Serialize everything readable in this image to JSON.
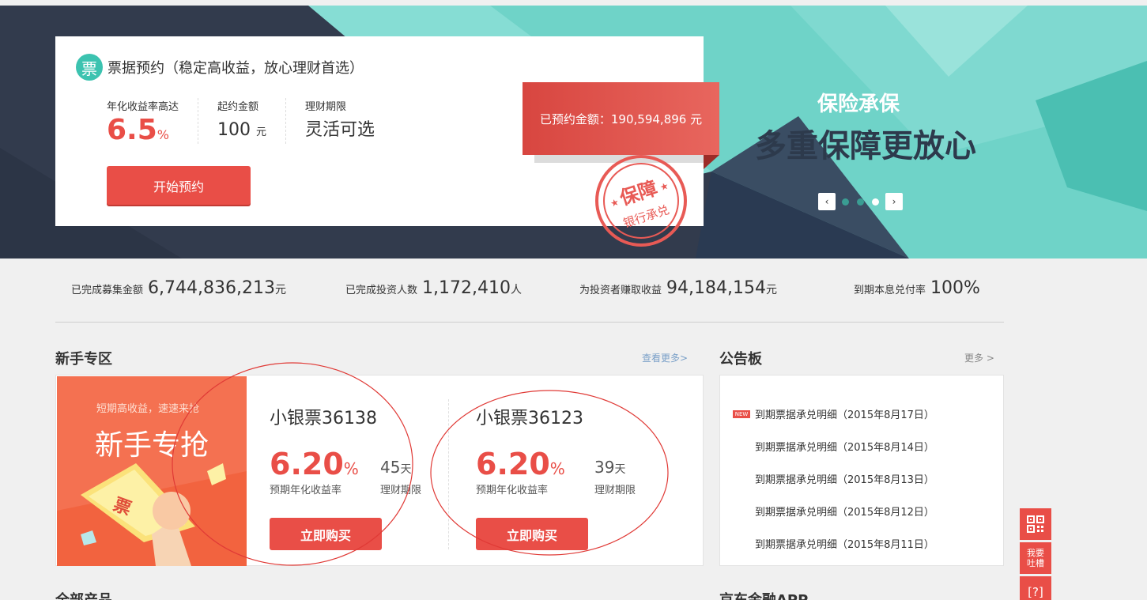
{
  "banner": {
    "promo_title": "票据预约（稳定高收益，放心理财首选）",
    "icon_char": "票",
    "cols": [
      {
        "label": "年化收益率高达",
        "value": "6.5",
        "unit": "%"
      },
      {
        "label": "起约金额",
        "value": "100",
        "unit": "元"
      },
      {
        "label": "理财期限",
        "value": "灵活可选"
      }
    ],
    "start_button": "开始预约",
    "booked_text": "已预约金额：190,594,896 元",
    "stamp_text_main": "保障",
    "stamp_text_sub": "银行承兑",
    "insurance_sub": "保险承保",
    "insurance_main": "多重保障更放心",
    "prev": "‹",
    "next": "›",
    "slides_total": 3,
    "slide_active": 3
  },
  "stats": [
    {
      "label": "已完成募集金额",
      "value": "6,744,836,213",
      "unit": "元"
    },
    {
      "label": "已完成投资人数",
      "value": "1,172,410",
      "unit": "人"
    },
    {
      "label": "为投资者赚取收益",
      "value": "94,184,154",
      "unit": "元"
    },
    {
      "label": "到期本息兑付率",
      "value": "100%",
      "unit": ""
    }
  ],
  "newbie": {
    "title": "新手专区",
    "more": "查看更多>",
    "promo_sub": "短期高收益，速速来抢",
    "promo_main": "新手专抢",
    "promo_ticket": "票",
    "products": [
      {
        "name": "小银票36138",
        "rate": "6.20",
        "rate_unit": "%",
        "days": "45",
        "days_unit": "天",
        "rate_label": "预期年化收益率",
        "days_label": "理财期限",
        "button": "立即购买"
      },
      {
        "name": "小银票36123",
        "rate": "6.20",
        "rate_unit": "%",
        "days": "39",
        "days_unit": "天",
        "rate_label": "预期年化收益率",
        "days_label": "理财期限",
        "button": "立即购买"
      }
    ]
  },
  "notice": {
    "title": "公告板",
    "more": "更多 >",
    "new_badge": "NEW",
    "items": [
      "到期票据承兑明细（2015年8月17日）",
      "到期票据承兑明细（2015年8月14日）",
      "到期票据承兑明细（2015年8月13日）",
      "到期票据承兑明细（2015年8月12日）",
      "到期票据承兑明细（2015年8月11日）"
    ]
  },
  "side_float": {
    "qr": "▦",
    "feedback": "我要\n吐槽",
    "help": "[?]"
  },
  "bottom": {
    "all_products": "全部产品",
    "app": "京东金融APP"
  },
  "colors": {
    "accent": "#e94e47",
    "teal": "#3cc3b0",
    "navy": "#323b4d"
  }
}
